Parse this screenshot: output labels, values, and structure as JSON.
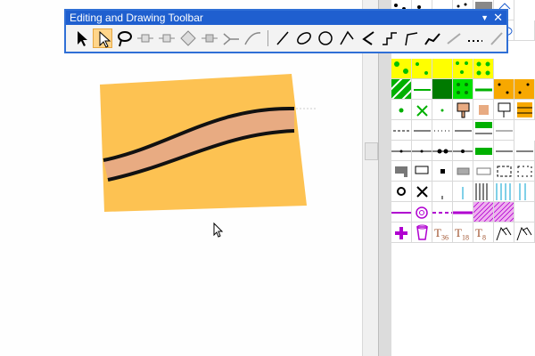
{
  "toolbar": {
    "title": "Editing and Drawing Toolbar",
    "active_tool": "edit-select-tool",
    "tools": [
      "select-arrow-icon",
      "edit-select-icon",
      "lasso-icon",
      "add-vertex-icon",
      "delete-vertex-icon",
      "move-vertex-icon",
      "split-icon",
      "join-icon",
      "reshape-icon",
      "line-icon",
      "ellipse-icon",
      "circle-icon",
      "arc-icon",
      "bezier-icon",
      "step-line-icon",
      "polyline-icon",
      "sketch-icon",
      "smooth-icon",
      "dotted-line-icon",
      "pen-icon"
    ]
  },
  "palette": {
    "text_symbols": [
      {
        "letter": "T",
        "sub": "36"
      },
      {
        "letter": "T",
        "sub": "18"
      },
      {
        "letter": "T",
        "sub": "8"
      }
    ]
  },
  "colors": {
    "area_fill": "#fdc252",
    "road_fill": "#e8ab82",
    "road_edge": "#111111",
    "title_bar": "#1f5fcf",
    "active_tool": "#ffd58a",
    "green": "#00b000",
    "magenta": "#b000d0"
  }
}
